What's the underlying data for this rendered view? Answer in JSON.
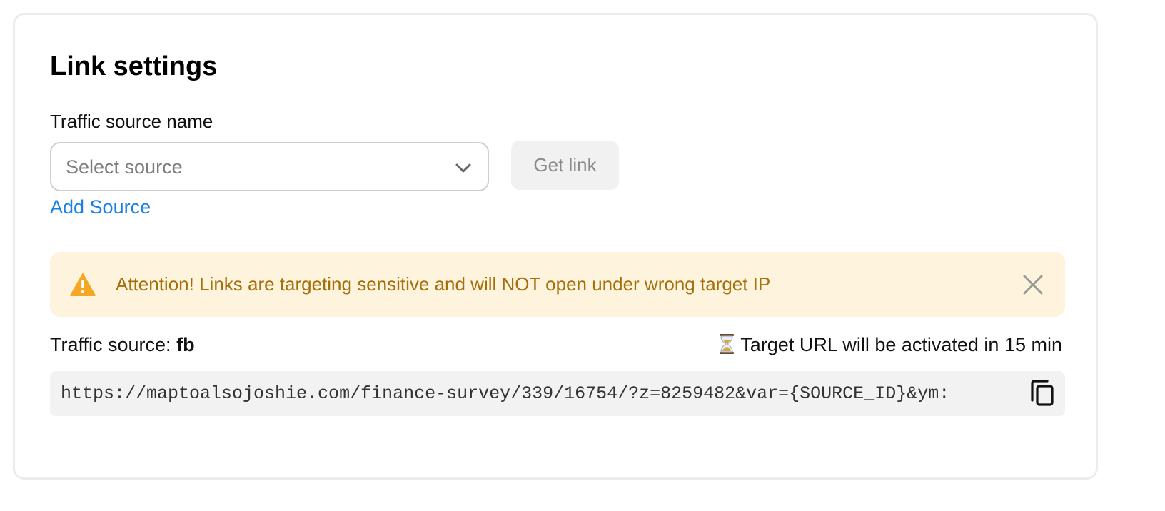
{
  "card": {
    "title": "Link settings"
  },
  "source_field": {
    "label": "Traffic source name",
    "placeholder": "Select source",
    "add_source_label": "Add Source"
  },
  "get_link_button": {
    "label": "Get link"
  },
  "alert": {
    "icon": "warning-triangle-icon",
    "message": "Attention! Links are targeting sensitive and will NOT open under wrong target IP",
    "accent_color": "#f5a623"
  },
  "link_info": {
    "source_prefix": "Traffic source:",
    "source_value": "fb",
    "activation_icon": "hourglass-icon",
    "activation_text": "Target URL will be activated in 15 min"
  },
  "generated_link": {
    "url": "https://maptoalsojoshie.com/finance-survey/339/16754/?z=8259482&var={SOURCE_ID}&ym:",
    "copy_icon": "copy-icon"
  }
}
